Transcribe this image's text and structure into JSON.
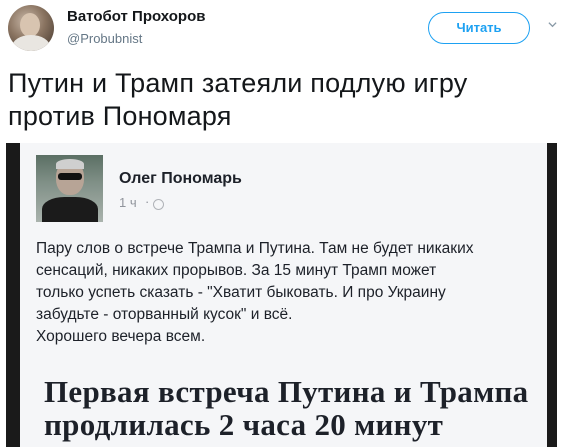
{
  "author": {
    "display_name": "Ватобот Прохоров",
    "handle": "@Probubnist"
  },
  "follow_button": {
    "label": "Читать"
  },
  "tweet": {
    "text_lines": [
      "Путин и Трамп затеяли подлую игру",
      "против Пономаря"
    ]
  },
  "embedded_post": {
    "author_name": "Олег Пономарь",
    "time": "1 ч",
    "separator": "·",
    "lines": [
      "Пару слов о встрече Трампа и Путина. Там не будет никаких",
      "сенсаций, никаких прорывов. За 15 минут Трамп может",
      "только успеть сказать - \"Хватит быковать. И про Украину",
      "забудьте - оторванный кусок\" и всё.",
      "Хорошего вечера всем."
    ],
    "headline_lines": [
      "Первая встреча Путина и Трампа",
      "продлилась 2 часа 20 минут"
    ]
  },
  "colors": {
    "accent": "#1da1f2",
    "text": "#14171a",
    "muted": "#657786"
  }
}
